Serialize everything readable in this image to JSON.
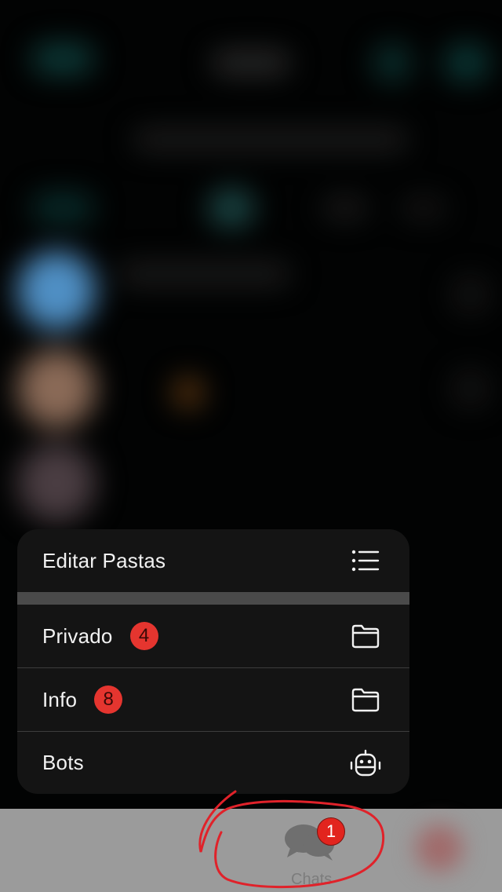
{
  "menu": {
    "items": [
      {
        "label": "Editar Pastas",
        "icon": "list-icon"
      },
      {
        "label": "Privado",
        "badge": "4",
        "icon": "folder-icon"
      },
      {
        "label": "Info",
        "badge": "8",
        "icon": "folder-icon"
      },
      {
        "label": "Bots",
        "icon": "robot-icon"
      }
    ]
  },
  "tabbar": {
    "chats": {
      "label": "Chats",
      "badge": "1",
      "icon": "chat-bubbles-icon"
    }
  },
  "colors": {
    "badge": "#e5352f",
    "annotation": "#e0222a",
    "menu_bg": "#141414",
    "tabbar_bg": "#9b9b9b"
  }
}
